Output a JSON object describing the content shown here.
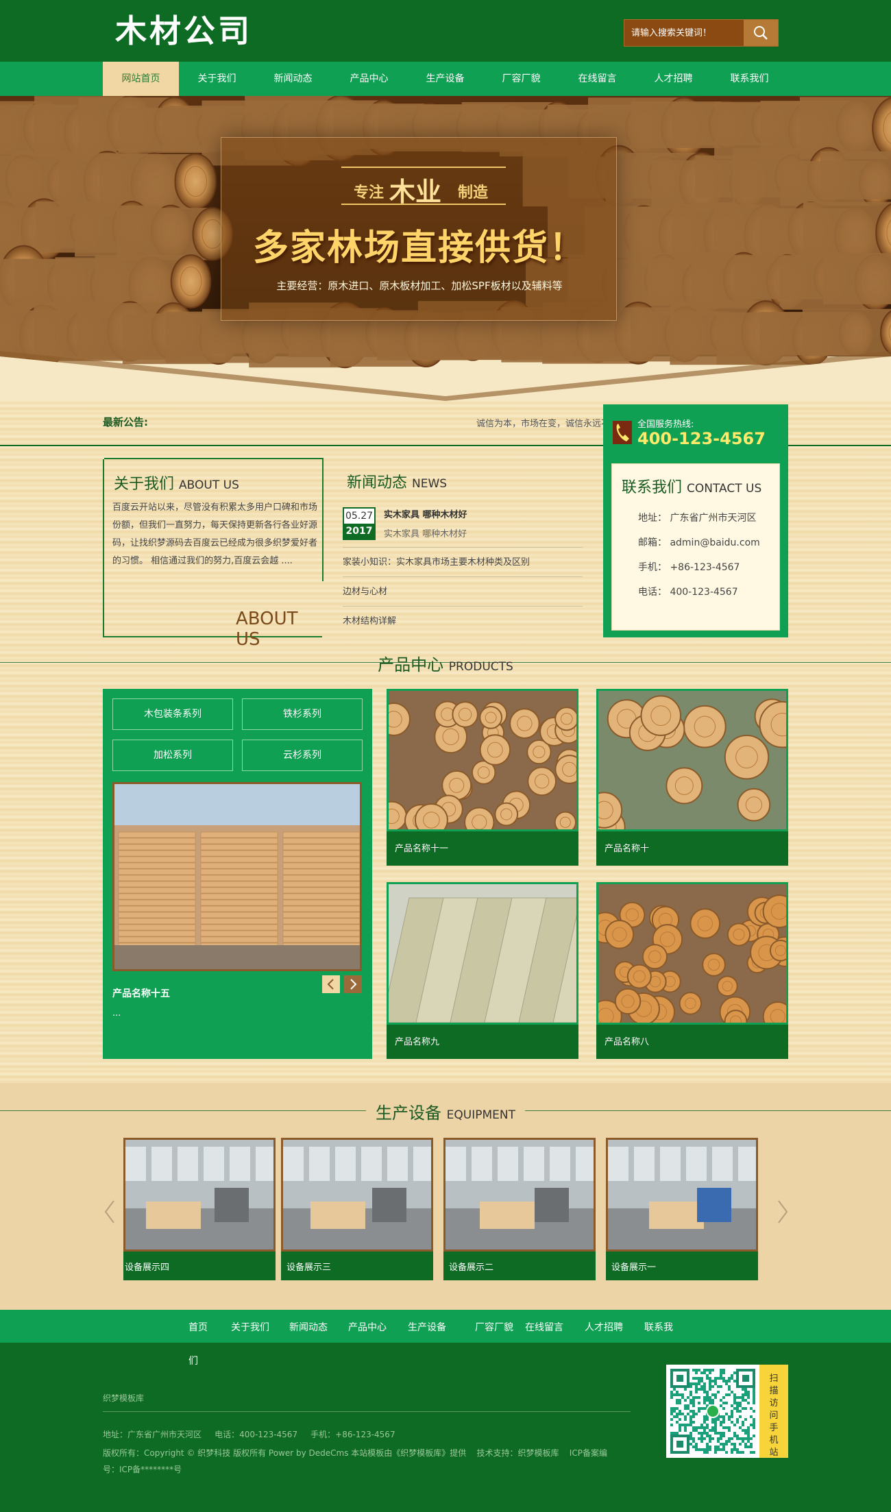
{
  "header": {
    "logo": "木材公司",
    "search_placeholder": "请输入搜索关键词！"
  },
  "nav": {
    "items": [
      "网站首页",
      "关于我们",
      "新闻动态",
      "产品中心",
      "生产设备",
      "厂容厂貌",
      "在线留言",
      "人才招聘",
      "联系我们"
    ],
    "active": 0
  },
  "banner": {
    "tag_left": "专注",
    "tag_big": "木业",
    "tag_right": "制造",
    "headline": "多家林场直接供货！",
    "sub": "主要经营：原木进口、原木板材加工、加松SPF板材以及辅料等"
  },
  "notice": {
    "label": "最新公告:",
    "text": "诚信为本，市场在变，诚信永远不变。"
  },
  "contact": {
    "hotline_label": "全国服务热线:",
    "hotline": "400-123-4567",
    "title_cn": "联系我们",
    "title_en": "CONTACT US",
    "rows": [
      "地址：  广东省广州市天河区",
      "邮箱：  admin@baidu.com",
      "手机：  +86-123-4567",
      "电话：  400-123-4567"
    ]
  },
  "about": {
    "title_cn": "关于我们",
    "title_en": "ABOUT US",
    "text": "百度云开站以来，尽管没有积累太多用户口碑和市场份额，但我们一直努力，每天保持更新各行各业好源码，让找织梦源码去百度云已经成为很多织梦爱好者的习惯。 相信通过我们的努力,百度云会越 ....",
    "big": "ABOUT US"
  },
  "news": {
    "title_cn": "新闻动态",
    "title_en": "NEWS",
    "date_day": "05.27",
    "date_year": "2017",
    "headline": "实木家具 哪种木材好",
    "headline_sub": "实木家具 哪种木材好",
    "items": [
      "家装小知识：实木家具市场主要木材种类及区别",
      "边材与心材",
      "木材结构详解"
    ]
  },
  "products": {
    "title_cn": "产品中心",
    "title_en": "PRODUCTS",
    "categories": [
      "木包装条系列",
      "铁杉系列",
      "加松系列",
      "云杉系列"
    ],
    "feature_name": "产品名称十五",
    "feature_desc": "...",
    "cards": [
      "产品名称十一",
      "产品名称十",
      "产品名称九",
      "产品名称八"
    ]
  },
  "equipment": {
    "title_cn": "生产设备",
    "title_en": "EQUIPMENT",
    "cards": [
      "设备展示四",
      "设备展示三",
      "设备展示二",
      "设备展示一"
    ]
  },
  "footer": {
    "nav": [
      "首页",
      "关于我们",
      "新闻动态",
      "产品中心",
      "生产设备",
      "厂容厂貌",
      "在线留言",
      "人才招聘",
      "联系我"
    ],
    "nav_wrap": "们",
    "site": "织梦模板库",
    "address_line": "地址：广东省广州市天河区     电话：400-123-4567     手机：+86-123-4567",
    "copyright": "版权所有：Copyright © 织梦科技 版权所有 Power by DedeCms 本站模板由《织梦模板库》提供    技术支持：织梦模板库    ICP备案编",
    "icp": "号：ICP备********号",
    "qr_label": "扫描访问手机站"
  },
  "colors": {
    "dark_green": "#0d6b24",
    "green": "#10a053",
    "cream": "#f6e7bf",
    "gold": "#ffd56a"
  }
}
